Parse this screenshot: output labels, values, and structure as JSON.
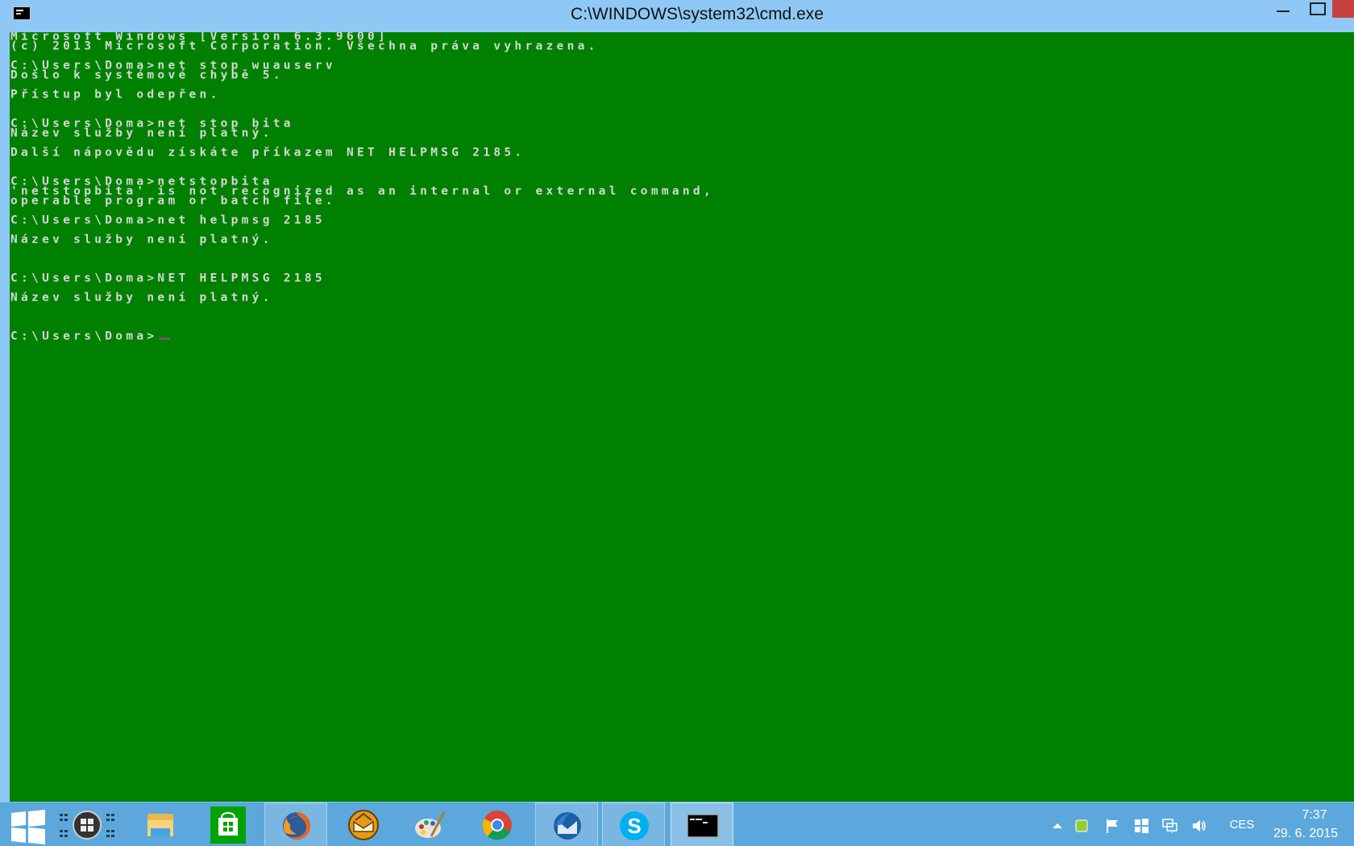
{
  "window": {
    "title": "C:\\WINDOWS\\system32\\cmd.exe"
  },
  "console": {
    "lines": [
      "Microsoft Windows [Version 6.3.9600]",
      "(c) 2013 Microsoft Corporation. Všechna práva vyhrazena.",
      "",
      "C:\\Users\\Doma>net stop wuauserv",
      "Došlo k systémové chybě 5.",
      "",
      "Přístup byl odepřen.",
      "",
      "",
      "C:\\Users\\Doma>net stop bita",
      "Název služby není platný.",
      "",
      "Další nápovědu získáte příkazem NET HELPMSG 2185.",
      "",
      "",
      "C:\\Users\\Doma>netstopbita",
      "'netstopbita' is not recognized as an internal or external command,",
      "operable program or batch file.",
      "",
      "C:\\Users\\Doma>net helpmsg 2185",
      "",
      "Název služby není platný.",
      "",
      "",
      "",
      "C:\\Users\\Doma>NET HELPMSG 2185",
      "",
      "Název služby není platný.",
      "",
      "",
      "",
      "C:\\Users\\Doma>"
    ],
    "colors": {
      "background": "#008000",
      "text": "#d6d6d6",
      "cursor": "#b23cb2"
    }
  },
  "taskbar": {
    "apps": [
      {
        "name": "task-view",
        "icon": "task-view-icon"
      },
      {
        "name": "file-explorer",
        "icon": "folder-icon"
      },
      {
        "name": "store",
        "icon": "store-icon"
      },
      {
        "name": "firefox",
        "icon": "firefox-icon"
      },
      {
        "name": "mail",
        "icon": "mail-icon"
      },
      {
        "name": "paint",
        "icon": "paint-icon"
      },
      {
        "name": "chrome",
        "icon": "chrome-icon"
      },
      {
        "name": "thunderbird",
        "icon": "thunderbird-icon"
      },
      {
        "name": "skype",
        "icon": "skype-icon"
      },
      {
        "name": "cmd",
        "icon": "cmd-icon"
      }
    ],
    "tray": {
      "language": "CES",
      "time": "7:37",
      "date": "29. 6. 2015"
    }
  }
}
